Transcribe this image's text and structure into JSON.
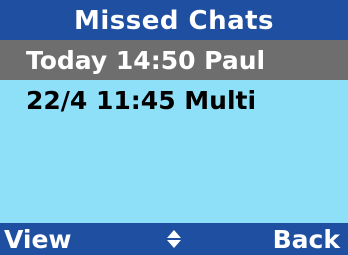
{
  "header": {
    "title": "Missed Chats"
  },
  "list": {
    "items": [
      {
        "label": "Today 14:50 Paul",
        "selected": true
      },
      {
        "label": "22/4 11:45 Multi",
        "selected": false
      }
    ]
  },
  "softkeys": {
    "left_label": "View",
    "center_icon": "up-down-arrows-icon",
    "right_label": "Back"
  },
  "colors": {
    "background": "#8ee0f8",
    "bars": "#1f4fa0",
    "selection": "#6e6e6e",
    "text_on_bar": "#ffffff"
  }
}
